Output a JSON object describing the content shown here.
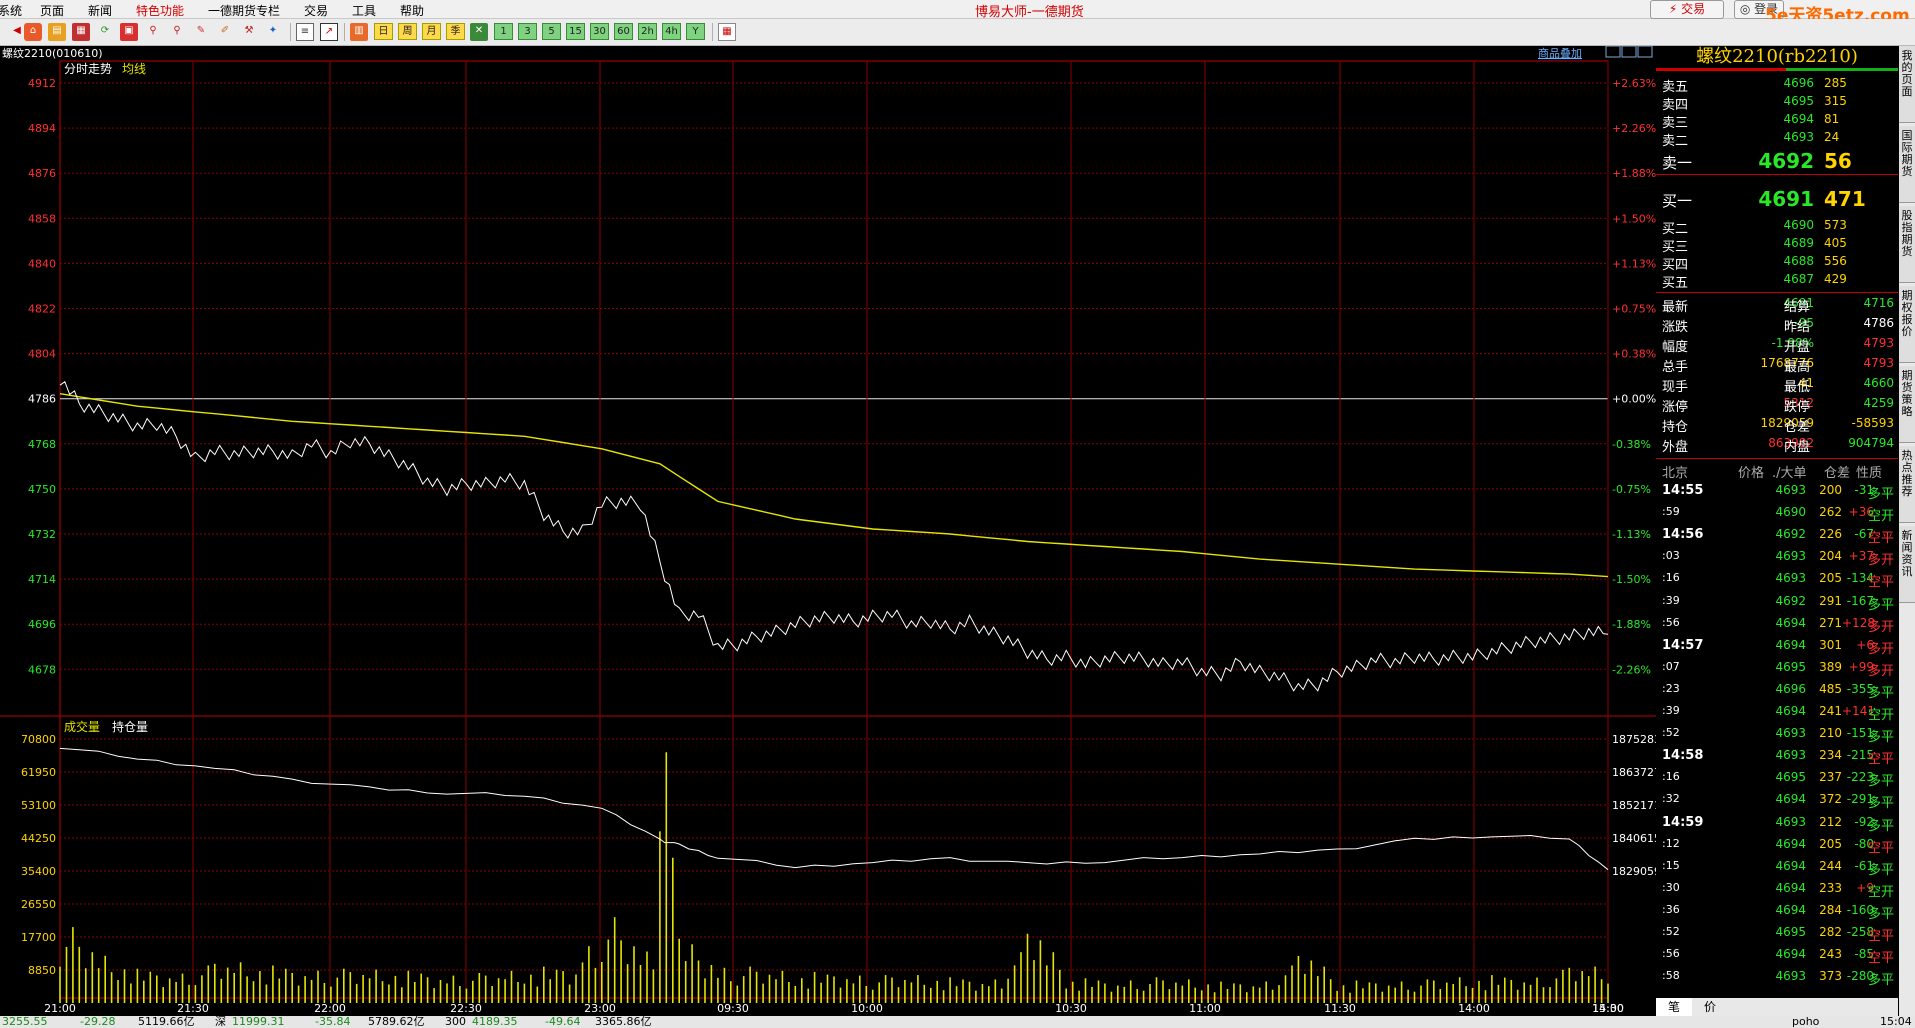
{
  "menu": {
    "items": [
      "系统",
      "页面",
      "新闻",
      "特色功能",
      "一德期货专栏",
      "交易",
      "工具",
      "帮助"
    ],
    "highlight_index": 3
  },
  "title": "博易大师-一德期货",
  "top_buttons": {
    "trade": "⚡ 交易",
    "login": "◎ 登录"
  },
  "watermark": "5e天资5etz.com",
  "toolbar": {
    "period_labels": [
      "日",
      "周",
      "月",
      "季",
      "1",
      "3",
      "5",
      "15",
      "30",
      "60",
      "2h",
      "4h",
      "Y"
    ],
    "icons": [
      "home-icon",
      "folder-icon",
      "refresh-icon",
      "compare-icon",
      "search-icon",
      "zoom-icon",
      "pen-icon",
      "draw-icon",
      "tool-icon",
      "news-icon",
      "table-icon",
      "chart-icon",
      "kline-icon"
    ]
  },
  "chart": {
    "instrument": "螺纹2210(010610)",
    "overlay_link": "商品叠加",
    "main_legend": [
      "分时走势",
      "均线"
    ],
    "sub_legend": [
      "成交量",
      "持仓量"
    ],
    "price_axis": [
      "4912",
      "4894",
      "4876",
      "4858",
      "4840",
      "4822",
      "4804",
      "4786",
      "4768",
      "4750",
      "4732",
      "4714",
      "4696",
      "4678"
    ],
    "pct_axis": [
      "+2.63%",
      "+2.26%",
      "+1.88%",
      "+1.50%",
      "+1.13%",
      "+0.75%",
      "+0.38%",
      "+0.00%",
      "-0.38%",
      "-0.75%",
      "-1.13%",
      "-1.50%",
      "-1.88%",
      "-2.26%"
    ],
    "pre_settle": "4786",
    "volume_axis": [
      "70800",
      "61950",
      "53100",
      "44250",
      "35400",
      "26550",
      "17700",
      "8850"
    ],
    "oi_axis": [
      "1875283",
      "1863727",
      "1852171",
      "1840615",
      "1829059"
    ],
    "time_labels": [
      "21:00",
      "21:30",
      "22:00",
      "22:30",
      "23:00",
      "09:30",
      "10:00",
      "10:30",
      "11:00",
      "11:30",
      "14:00",
      "14:30",
      "15:00"
    ]
  },
  "chart_data": {
    "type": "line",
    "time_session_marks": [
      "21:00",
      "21:30",
      "22:00",
      "22:30",
      "23:00",
      "09:30",
      "10:00",
      "10:30",
      "11:00",
      "11:30",
      "14:00",
      "14:30",
      "15:00"
    ],
    "ylim": [
      4670,
      4912
    ],
    "series": [
      {
        "name": "分时走势",
        "points": [
          [
            0,
            4794
          ],
          [
            1,
            4784
          ],
          [
            2,
            4781
          ],
          [
            3,
            4778
          ],
          [
            4,
            4775
          ],
          [
            5,
            4776
          ],
          [
            6,
            4771
          ],
          [
            7,
            4762
          ],
          [
            8,
            4765
          ],
          [
            9,
            4764
          ],
          [
            10,
            4765
          ],
          [
            11,
            4765
          ],
          [
            12,
            4763
          ],
          [
            13,
            4768
          ],
          [
            14,
            4764
          ],
          [
            15,
            4769
          ],
          [
            16,
            4768
          ],
          [
            17,
            4763
          ],
          [
            18,
            4759
          ],
          [
            19,
            4753
          ],
          [
            20,
            4750
          ],
          [
            21,
            4752
          ],
          [
            22,
            4752
          ],
          [
            23,
            4754
          ],
          [
            24,
            4752
          ],
          [
            25,
            4740
          ],
          [
            26,
            4733
          ],
          [
            27,
            4733
          ],
          [
            28,
            4744
          ],
          [
            29,
            4745
          ],
          [
            30,
            4744
          ],
          [
            31,
            4721
          ],
          [
            32,
            4700
          ],
          [
            33,
            4700
          ],
          [
            34,
            4687
          ],
          [
            35,
            4688
          ],
          [
            36,
            4691
          ],
          [
            37,
            4693
          ],
          [
            38,
            4696
          ],
          [
            39,
            4698
          ],
          [
            40,
            4699
          ],
          [
            41,
            4697
          ],
          [
            42,
            4699
          ],
          [
            43,
            4700
          ],
          [
            44,
            4696
          ],
          [
            45,
            4697
          ],
          [
            46,
            4694
          ],
          [
            47,
            4697
          ],
          [
            48,
            4693
          ],
          [
            49,
            4690
          ],
          [
            50,
            4685
          ],
          [
            51,
            4682
          ],
          [
            52,
            4683
          ],
          [
            53,
            4680
          ],
          [
            54,
            4682
          ],
          [
            55,
            4683
          ],
          [
            56,
            4682
          ],
          [
            57,
            4680
          ],
          [
            58,
            4681
          ],
          [
            59,
            4677
          ],
          [
            60,
            4676
          ],
          [
            61,
            4681
          ],
          [
            62,
            4677
          ],
          [
            63,
            4675
          ],
          [
            64,
            4671
          ],
          [
            65,
            4672
          ],
          [
            66,
            4677
          ],
          [
            67,
            4679
          ],
          [
            68,
            4682
          ],
          [
            69,
            4681
          ],
          [
            70,
            4683
          ],
          [
            71,
            4682
          ],
          [
            72,
            4683
          ],
          [
            73,
            4683
          ],
          [
            74,
            4685
          ],
          [
            75,
            4687
          ],
          [
            76,
            4689
          ],
          [
            77,
            4690
          ],
          [
            78,
            4691
          ],
          [
            79,
            4693
          ],
          [
            80,
            4692
          ]
        ]
      },
      {
        "name": "均线",
        "points": [
          [
            0,
            4788
          ],
          [
            4,
            4783
          ],
          [
            8,
            4780
          ],
          [
            12,
            4777
          ],
          [
            16,
            4775
          ],
          [
            20,
            4773
          ],
          [
            24,
            4771
          ],
          [
            28,
            4766
          ],
          [
            31,
            4760
          ],
          [
            32,
            4755
          ],
          [
            34,
            4745
          ],
          [
            38,
            4738
          ],
          [
            42,
            4734
          ],
          [
            46,
            4732
          ],
          [
            50,
            4729
          ],
          [
            54,
            4727
          ],
          [
            58,
            4725
          ],
          [
            62,
            4722
          ],
          [
            66,
            4720
          ],
          [
            70,
            4718
          ],
          [
            74,
            4717
          ],
          [
            78,
            4716
          ],
          [
            80,
            4715
          ]
        ]
      },
      {
        "name": "持仓量",
        "points": [
          [
            0,
            1872500
          ],
          [
            4,
            1868500
          ],
          [
            8,
            1865000
          ],
          [
            12,
            1861000
          ],
          [
            16,
            1858000
          ],
          [
            20,
            1856500
          ],
          [
            24,
            1855500
          ],
          [
            28,
            1851000
          ],
          [
            31,
            1840000
          ],
          [
            32,
            1838000
          ],
          [
            34,
            1834000
          ],
          [
            38,
            1830500
          ],
          [
            42,
            1832000
          ],
          [
            46,
            1833500
          ],
          [
            50,
            1831500
          ],
          [
            54,
            1832500
          ],
          [
            58,
            1834000
          ],
          [
            62,
            1835000
          ],
          [
            66,
            1836500
          ],
          [
            70,
            1840000
          ],
          [
            74,
            1841500
          ],
          [
            78,
            1840500
          ],
          [
            80,
            1829500
          ]
        ]
      },
      {
        "name": "成交量",
        "points": [
          [
            0,
            17700
          ],
          [
            2,
            11000
          ],
          [
            4,
            8000
          ],
          [
            6,
            7500
          ],
          [
            8,
            10000
          ],
          [
            10,
            9000
          ],
          [
            12,
            8500
          ],
          [
            14,
            8000
          ],
          [
            16,
            7800
          ],
          [
            18,
            7500
          ],
          [
            20,
            7000
          ],
          [
            22,
            7000
          ],
          [
            24,
            8000
          ],
          [
            26,
            9000
          ],
          [
            28,
            20000
          ],
          [
            30,
            12000
          ],
          [
            31,
            70800
          ],
          [
            32,
            15000
          ],
          [
            33,
            12000
          ],
          [
            34,
            9000
          ],
          [
            36,
            8000
          ],
          [
            38,
            7000
          ],
          [
            40,
            7500
          ],
          [
            42,
            6500
          ],
          [
            44,
            6500
          ],
          [
            46,
            6000
          ],
          [
            48,
            6000
          ],
          [
            50,
            17700
          ],
          [
            52,
            6000
          ],
          [
            54,
            5500
          ],
          [
            56,
            6000
          ],
          [
            58,
            5500
          ],
          [
            60,
            5000
          ],
          [
            62,
            5500
          ],
          [
            64,
            12000
          ],
          [
            66,
            5000
          ],
          [
            68,
            5500
          ],
          [
            70,
            5500
          ],
          [
            72,
            6000
          ],
          [
            74,
            6500
          ],
          [
            76,
            6500
          ],
          [
            78,
            9000
          ],
          [
            80,
            8000
          ]
        ]
      }
    ]
  },
  "quote": {
    "title": "螺纹2210(rb2210)",
    "asks": [
      {
        "label": "卖五",
        "price": "4696",
        "vol": "285"
      },
      {
        "label": "卖四",
        "price": "4695",
        "vol": "315"
      },
      {
        "label": "卖三",
        "price": "4694",
        "vol": "81"
      },
      {
        "label": "卖二",
        "price": "4693",
        "vol": "24"
      },
      {
        "label": "卖一",
        "price": "4692",
        "vol": "56"
      }
    ],
    "bids": [
      {
        "label": "买一",
        "price": "4691",
        "vol": "471"
      },
      {
        "label": "买二",
        "price": "4690",
        "vol": "573"
      },
      {
        "label": "买三",
        "price": "4689",
        "vol": "405"
      },
      {
        "label": "买四",
        "price": "4688",
        "vol": "556"
      },
      {
        "label": "买五",
        "price": "4687",
        "vol": "429"
      }
    ],
    "stats": [
      {
        "l1": "最新",
        "v1": "4691",
        "c1": "green",
        "l2": "结算",
        "v2": "4716",
        "c2": "green"
      },
      {
        "l1": "涨跌",
        "v1": "-95",
        "c1": "green",
        "l2": "昨结",
        "v2": "4786",
        "c2": "white"
      },
      {
        "l1": "幅度",
        "v1": "-1.98%",
        "c1": "green",
        "l2": "开盘",
        "v2": "4793",
        "c2": "red"
      },
      {
        "l1": "总手",
        "v1": "1768776",
        "c1": "yellow",
        "l2": "最高",
        "v2": "4793",
        "c2": "red"
      },
      {
        "l1": "现手",
        "v1": "41",
        "c1": "yellow",
        "l2": "最低",
        "v2": "4660",
        "c2": "green"
      },
      {
        "l1": "涨停",
        "v1": "5312",
        "c1": "red",
        "l2": "跌停",
        "v2": "4259",
        "c2": "green"
      },
      {
        "l1": "持仓",
        "v1": "1829059",
        "c1": "yellow",
        "l2": "仓差",
        "v2": "-58593",
        "c2": "yellow"
      },
      {
        "l1": "外盘",
        "v1": "863982",
        "c1": "red",
        "l2": "内盘",
        "v2": "904794",
        "c2": "green"
      }
    ],
    "tick_header": [
      "北京",
      "价格",
      "./大单",
      "仓差",
      "性质"
    ],
    "ticks": [
      {
        "t": "14:55",
        "p": "4693",
        "v": "200",
        "d": "-31",
        "n": "多平",
        "nc": "green",
        "m": true
      },
      {
        "t": ":59",
        "p": "4690",
        "v": "262",
        "d": "+36",
        "n": "空开",
        "nc": "green",
        "m": false
      },
      {
        "t": "14:56",
        "p": "4692",
        "v": "226",
        "d": "-67",
        "n": "空平",
        "nc": "red",
        "m": true
      },
      {
        "t": ":03",
        "p": "4693",
        "v": "204",
        "d": "+37",
        "n": "多开",
        "nc": "red",
        "m": false
      },
      {
        "t": ":16",
        "p": "4693",
        "v": "205",
        "d": "-134",
        "n": "空平",
        "nc": "red",
        "m": false
      },
      {
        "t": ":39",
        "p": "4692",
        "v": "291",
        "d": "-167",
        "n": "多平",
        "nc": "green",
        "m": false
      },
      {
        "t": ":56",
        "p": "4694",
        "v": "271",
        "d": "+128",
        "n": "多开",
        "nc": "red",
        "m": false
      },
      {
        "t": "14:57",
        "p": "4694",
        "v": "301",
        "d": "+6",
        "n": "多开",
        "nc": "red",
        "m": true
      },
      {
        "t": ":07",
        "p": "4695",
        "v": "389",
        "d": "+99",
        "n": "多开",
        "nc": "red",
        "m": false
      },
      {
        "t": ":23",
        "p": "4696",
        "v": "485",
        "d": "-355",
        "n": "多平",
        "nc": "green",
        "m": false
      },
      {
        "t": ":39",
        "p": "4694",
        "v": "241",
        "d": "+141",
        "n": "空开",
        "nc": "green",
        "m": false
      },
      {
        "t": ":52",
        "p": "4693",
        "v": "210",
        "d": "-151",
        "n": "多平",
        "nc": "green",
        "m": false
      },
      {
        "t": "14:58",
        "p": "4693",
        "v": "234",
        "d": "-215",
        "n": "空平",
        "nc": "red",
        "m": true
      },
      {
        "t": ":16",
        "p": "4695",
        "v": "237",
        "d": "-223",
        "n": "多平",
        "nc": "green",
        "m": false
      },
      {
        "t": ":32",
        "p": "4694",
        "v": "372",
        "d": "-291",
        "n": "多平",
        "nc": "green",
        "m": false
      },
      {
        "t": "14:59",
        "p": "4693",
        "v": "212",
        "d": "-92",
        "n": "多平",
        "nc": "green",
        "m": true
      },
      {
        "t": ":12",
        "p": "4694",
        "v": "205",
        "d": "-80",
        "n": "空平",
        "nc": "red",
        "m": false
      },
      {
        "t": ":15",
        "p": "4694",
        "v": "244",
        "d": "-61",
        "n": "多平",
        "nc": "green",
        "m": false
      },
      {
        "t": ":30",
        "p": "4694",
        "v": "233",
        "d": "+9",
        "n": "空开",
        "nc": "green",
        "m": false
      },
      {
        "t": ":36",
        "p": "4694",
        "v": "284",
        "d": "-160",
        "n": "多平",
        "nc": "green",
        "m": false
      },
      {
        "t": ":52",
        "p": "4695",
        "v": "282",
        "d": "-258",
        "n": "空平",
        "nc": "red",
        "m": false
      },
      {
        "t": ":56",
        "p": "4694",
        "v": "243",
        "d": "-85",
        "n": "空平",
        "nc": "red",
        "m": false
      },
      {
        "t": ":58",
        "p": "4693",
        "v": "373",
        "d": "-280",
        "n": "多平",
        "nc": "green",
        "m": false
      }
    ],
    "bottom_tabs": [
      "笔",
      "价"
    ]
  },
  "side_tabs": [
    "我的页面",
    "国际期货",
    "股指期货",
    "期权报价",
    "期货策略",
    "热点推荐",
    "新闻资讯"
  ],
  "status": [
    "3255.55",
    "-29.28",
    "5119.66亿",
    "深",
    "11999.31",
    "-35.84",
    "5789.62亿",
    "300",
    "4189.35",
    "-49.64",
    "3365.86亿",
    "poho",
    "15:04"
  ]
}
